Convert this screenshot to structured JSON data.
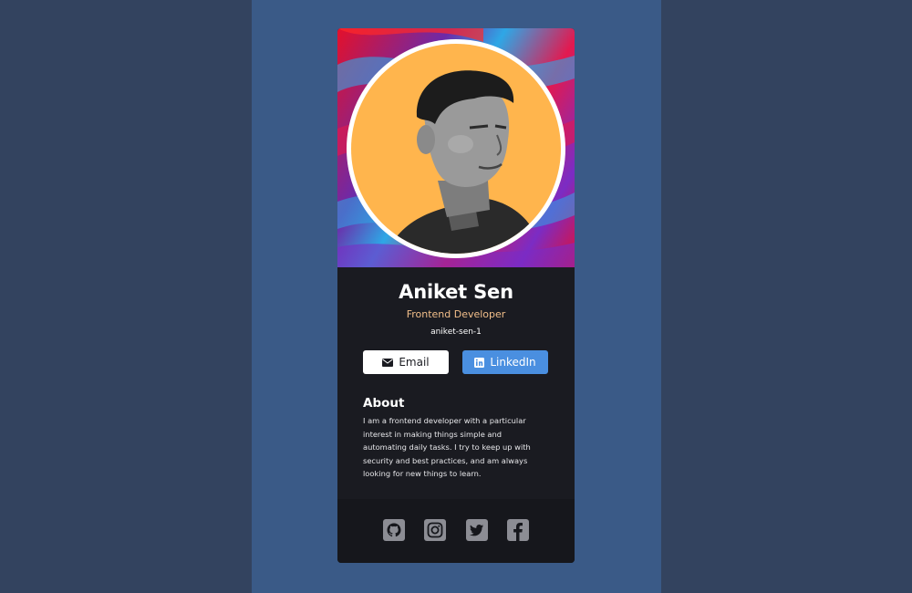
{
  "profile": {
    "name": "Aniket Sen",
    "role": "Frontend Developer",
    "handle": "aniket-sen-1"
  },
  "buttons": {
    "email_label": "Email",
    "linkedin_label": "LinkedIn"
  },
  "about": {
    "title": "About",
    "text_lines": [
      "I am a frontend developer with a particular",
      "interest in making things simple and",
      "automating daily tasks. I try to keep up with",
      "security and best practices, and am always",
      "looking for new things to learn."
    ]
  },
  "social_icons": [
    "github-icon",
    "instagram-icon",
    "twitter-icon",
    "facebook-icon"
  ],
  "colors": {
    "page_bg": "#33435f",
    "column_bg": "#3a5a87",
    "card_bg": "#1a1b21",
    "footer_bg": "#16171c",
    "role_text": "#f3bf8a",
    "linkedin_button": "#4a8fe0",
    "avatar_bg": "#ffb54d",
    "social_icon": "#8c8d94"
  }
}
